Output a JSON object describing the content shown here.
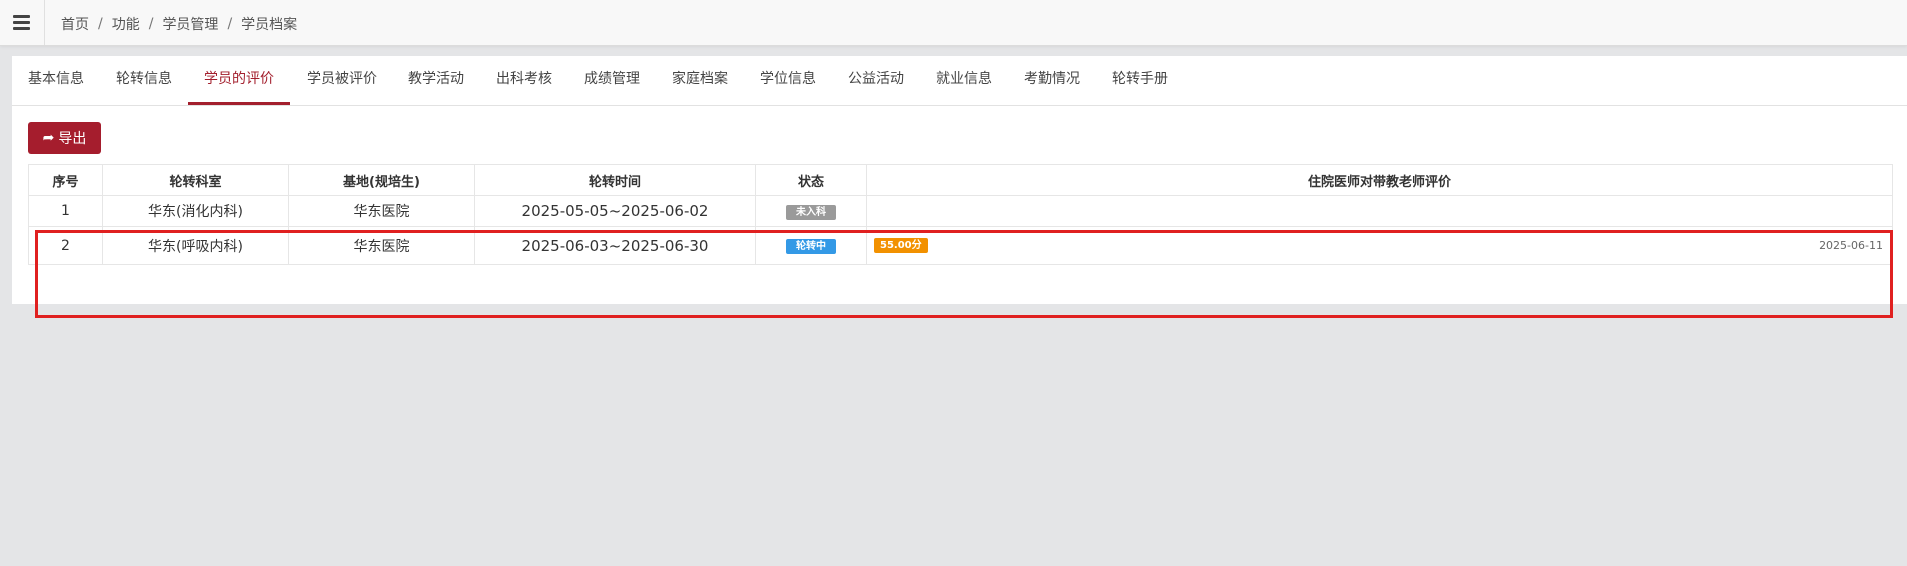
{
  "menu_icon": "hamburger-icon",
  "breadcrumb": [
    "首页",
    "功能",
    "学员管理",
    "学员档案"
  ],
  "breadcrumb_separator": "/",
  "tabs": [
    {
      "label": "基本信息",
      "active": false
    },
    {
      "label": "轮转信息",
      "active": false
    },
    {
      "label": "学员的评价",
      "active": true
    },
    {
      "label": "学员被评价",
      "active": false
    },
    {
      "label": "教学活动",
      "active": false
    },
    {
      "label": "出科考核",
      "active": false
    },
    {
      "label": "成绩管理",
      "active": false
    },
    {
      "label": "家庭档案",
      "active": false
    },
    {
      "label": "学位信息",
      "active": false
    },
    {
      "label": "公益活动",
      "active": false
    },
    {
      "label": "就业信息",
      "active": false
    },
    {
      "label": "考勤情况",
      "active": false
    },
    {
      "label": "轮转手册",
      "active": false
    }
  ],
  "export_button": {
    "label": "导出",
    "icon": "share-icon"
  },
  "table": {
    "headers": [
      "序号",
      "轮转科室",
      "基地(规培生)",
      "轮转时间",
      "状态",
      "住院医师对带教老师评价"
    ],
    "rows": [
      {
        "index": "1",
        "dept": "华东(消化内科)",
        "base": "华东医院",
        "period": "2025-05-05~2025-06-02",
        "status": "未入科",
        "score": "",
        "eval_date": ""
      },
      {
        "index": "2",
        "dept": "华东(呼吸内科)",
        "base": "华东医院",
        "period": "2025-06-03~2025-06-30",
        "status": "轮转中",
        "score": "55.00分",
        "eval_date": "2025-06-11"
      }
    ]
  },
  "colors": {
    "accent": "#a31f2d",
    "status_not_entered": "#9a9a9a",
    "status_rotating": "#3399e6",
    "score_badge": "#f29100",
    "annotation": "#e02020"
  }
}
